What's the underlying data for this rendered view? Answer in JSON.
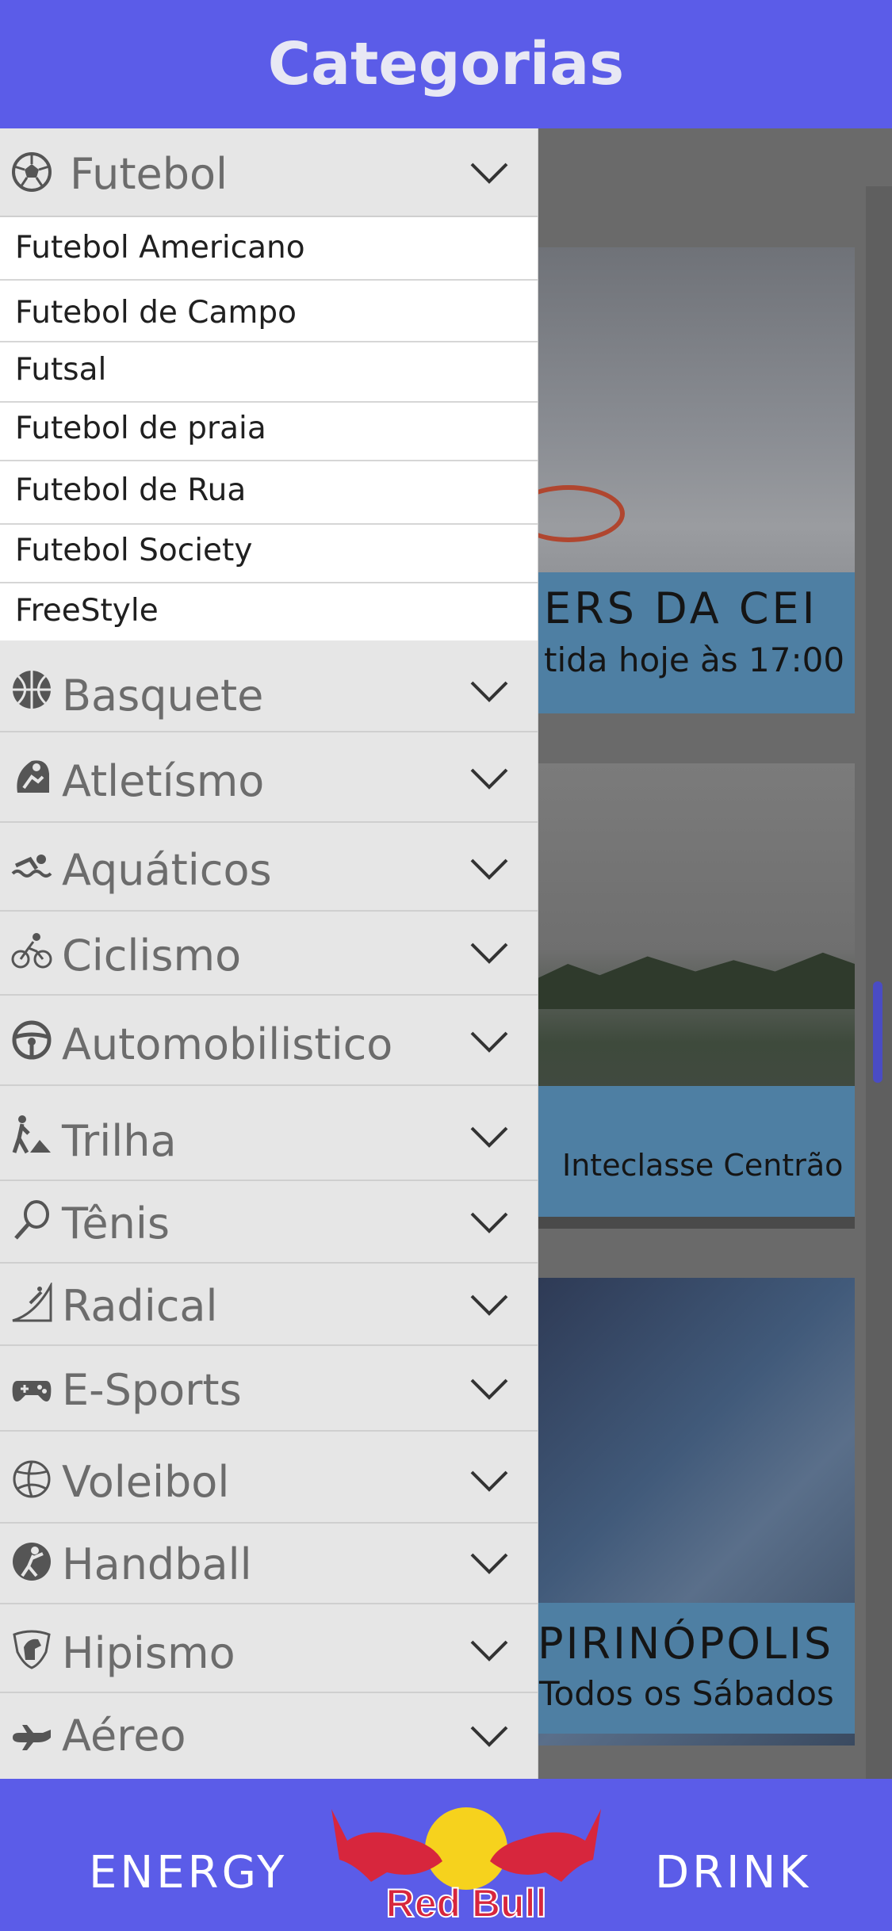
{
  "header": {
    "title": "Categorias"
  },
  "background_cards": [
    {
      "title": "ERS DA CEI",
      "subtitle": "tida hoje às 17:00"
    },
    {
      "title": "Inteclasse Centrão"
    },
    {
      "title": "PIRINÓPOLIS",
      "subtitle": "Todos os Sábados"
    }
  ],
  "drawer": {
    "expanded_category": {
      "label": "Futebol",
      "icon": "soccer-ball-icon"
    },
    "subcategories": [
      "Futebol Americano",
      "Futebol de Campo",
      "Futsal",
      "Futebol de praia",
      "Futebol de Rua",
      "Futebol Society",
      "FreeStyle"
    ],
    "categories": [
      {
        "label": "Basquete",
        "icon": "basketball-icon"
      },
      {
        "label": "Atletísmo",
        "icon": "runner-icon"
      },
      {
        "label": "Aquáticos",
        "icon": "swimmer-icon"
      },
      {
        "label": "Ciclismo",
        "icon": "cyclist-icon"
      },
      {
        "label": "Automobilistico",
        "icon": "steering-wheel-icon"
      },
      {
        "label": "Trilha",
        "icon": "hiker-icon"
      },
      {
        "label": "Tênis",
        "icon": "tennis-racket-icon"
      },
      {
        "label": "Radical",
        "icon": "skate-ramp-icon"
      },
      {
        "label": "E-Sports",
        "icon": "gamepad-icon"
      },
      {
        "label": "Voleibol",
        "icon": "volleyball-icon"
      },
      {
        "label": "Handball",
        "icon": "handball-icon"
      },
      {
        "label": "Hipismo",
        "icon": "horse-head-icon"
      },
      {
        "label": "Aéreo",
        "icon": "airplane-icon"
      }
    ]
  },
  "footer": {
    "left_text": "ENERGY",
    "right_text": "DRINK",
    "logo_text": "Red Bull"
  },
  "colors": {
    "brand": "#5b5ce8",
    "drawer": "#e6e6e6",
    "logo_red": "#d7263d",
    "logo_yellow": "#f6d21d"
  }
}
